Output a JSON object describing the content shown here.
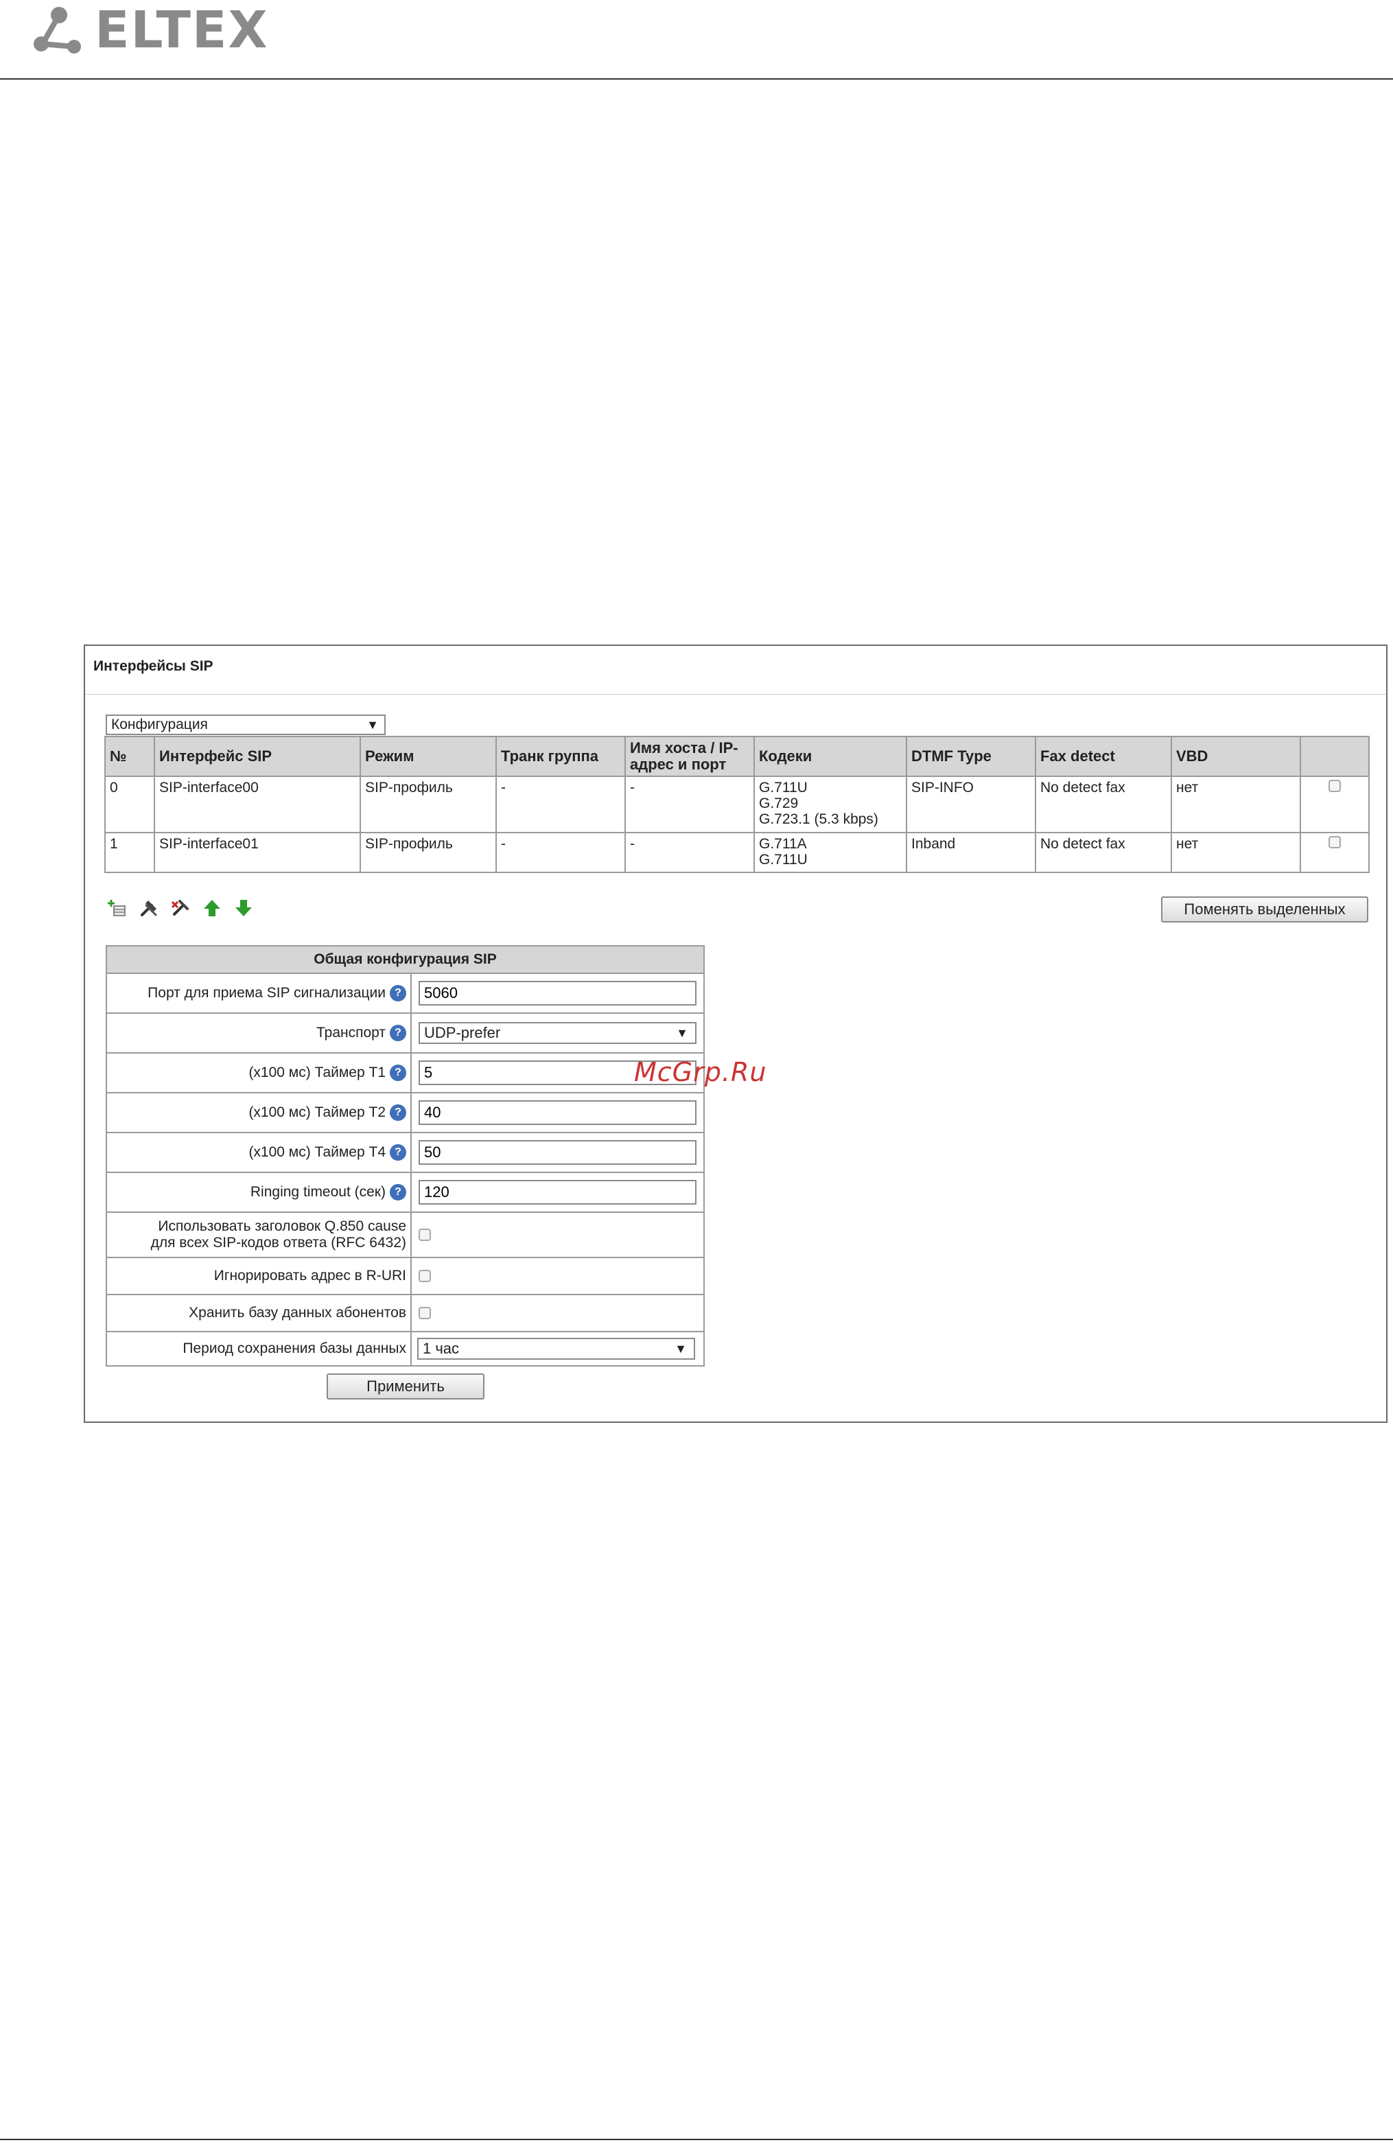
{
  "brand": {
    "name": "ELTEX"
  },
  "panel": {
    "title": "Интерфейсы SIP",
    "view_select": "Конфигурация"
  },
  "table": {
    "headers": [
      "№",
      "Интерфейс SIP",
      "Режим",
      "Транк группа",
      "Имя хоста / IP-адрес и порт",
      "Кодеки",
      "DTMF Type",
      "Fax detect",
      "VBD",
      ""
    ],
    "rows": [
      {
        "num": "0",
        "iface": "SIP-interface00",
        "mode": "SIP-профиль",
        "trunk": "-",
        "host": "-",
        "codecs": [
          "G.711U",
          "G.729",
          "G.723.1 (5.3 kbps)"
        ],
        "dtmf": "SIP-INFO",
        "fax": "No detect fax",
        "vbd": "нет"
      },
      {
        "num": "1",
        "iface": "SIP-interface01",
        "mode": "SIP-профиль",
        "trunk": "-",
        "host": "-",
        "codecs": [
          "G.711A",
          "G.711U"
        ],
        "dtmf": "Inband",
        "fax": "No detect fax",
        "vbd": "нет"
      }
    ]
  },
  "toolbar": {
    "icons": [
      "add-icon",
      "edit-icon",
      "delete-icon",
      "move-up-icon",
      "move-down-icon"
    ],
    "change_selected": "Поменять выделенных"
  },
  "config": {
    "title": "Общая конфигурация SIP",
    "sip_port_label": "Порт для приема SIP сигнализации",
    "sip_port_value": "5060",
    "transport_label": "Транспорт",
    "transport_value": "UDP-prefer",
    "t1_label": "(x100 мс) Таймер T1",
    "t1_value": "5",
    "t2_label": "(x100 мс) Таймер T2",
    "t2_value": "40",
    "t4_label": "(x100 мс) Таймер T4",
    "t4_value": "50",
    "ringing_label": "Ringing timeout (сек)",
    "ringing_value": "120",
    "q850_label_1": "Использовать заголовок Q.850 cause",
    "q850_label_2": "для всех SIP-кодов ответа (RFC 6432)",
    "ignore_ruri_label": "Игнорировать адрес в R-URI",
    "store_db_label": "Хранить базу данных абонентов",
    "db_period_label": "Период сохранения базы данных",
    "db_period_value": "1 час",
    "apply": "Применить"
  },
  "watermark": "McGrp.Ru",
  "colors": {
    "header_bg": "#d6d6d6",
    "border": "#9a9a9a",
    "brand_gray": "#8a8a8a",
    "help_blue": "#3f6fb8",
    "arrow_green": "#2e9b2e",
    "watermark": "#cc3333"
  }
}
